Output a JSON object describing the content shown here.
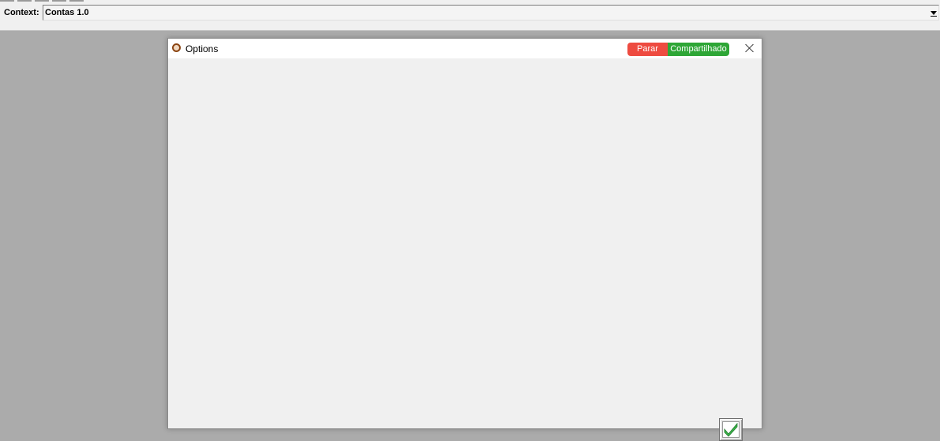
{
  "context": {
    "label": "Context:",
    "value": "Contas 1.0"
  },
  "dialog": {
    "title": "Options",
    "stop_label": "Parar",
    "shared_label": "Compartilhado",
    "colors": {
      "stop": "#ee4b40",
      "shared": "#2ea636",
      "confirm": "#3cb44a"
    },
    "icons": {
      "app": "app-icon",
      "close": "close-icon",
      "confirm": "check-icon"
    }
  }
}
